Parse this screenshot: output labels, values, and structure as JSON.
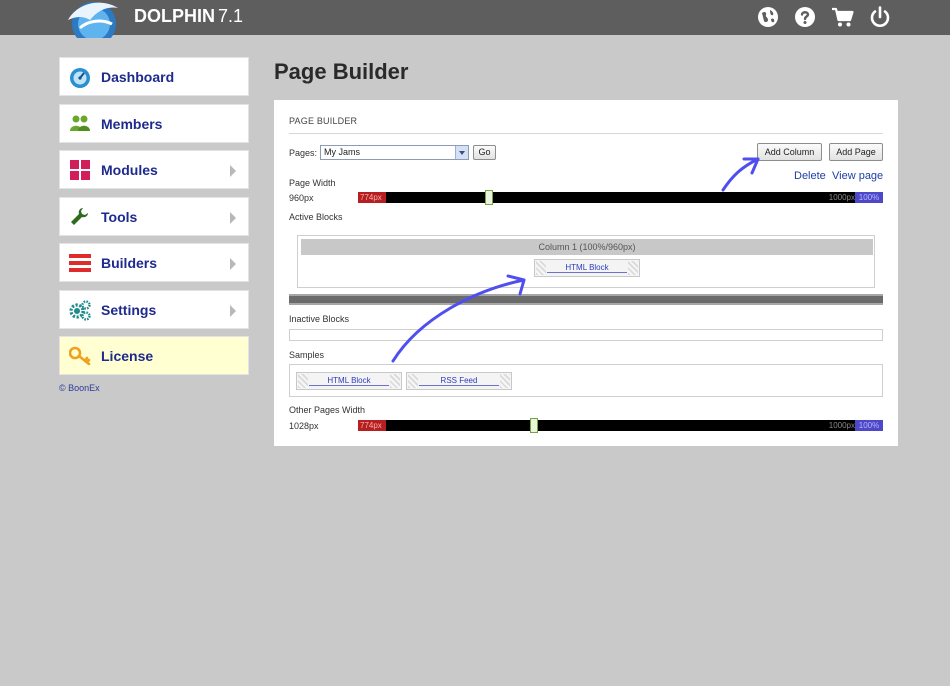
{
  "app": {
    "name": "DOLPHIN",
    "version": "7.1"
  },
  "topbar_icons": [
    "globe-icon",
    "help-icon",
    "cart-icon",
    "power-icon"
  ],
  "sidebar": {
    "items": [
      {
        "label": "Dashboard",
        "icon": "dashboard-icon",
        "has_arrow": false
      },
      {
        "label": "Members",
        "icon": "members-icon",
        "has_arrow": false
      },
      {
        "label": "Modules",
        "icon": "modules-icon",
        "has_arrow": true
      },
      {
        "label": "Tools",
        "icon": "wrench-icon",
        "has_arrow": true
      },
      {
        "label": "Builders",
        "icon": "builders-icon",
        "has_arrow": true
      },
      {
        "label": "Settings",
        "icon": "gears-icon",
        "has_arrow": true
      },
      {
        "label": "License",
        "icon": "key-icon",
        "has_arrow": false
      }
    ],
    "copyright": "© BoonEx"
  },
  "page_title": "Page Builder",
  "panel": {
    "heading": "PAGE BUILDER",
    "pages_label": "Pages:",
    "pages_selected": "My Jams",
    "go_button": "Go",
    "add_column_button": "Add Column",
    "add_page_button": "Add Page",
    "delete_link": "Delete",
    "view_page_link": "View page",
    "page_width": {
      "label": "Page Width",
      "value": "960px",
      "min_label": "774px",
      "max_label": "1000px",
      "pct_label": "100%",
      "fraction": 0.246
    },
    "active_blocks": {
      "label": "Active Blocks",
      "column_title": "Column 1 (100%/960px)",
      "blocks": [
        "HTML Block"
      ]
    },
    "inactive_blocks_label": "Inactive Blocks",
    "samples": {
      "label": "Samples",
      "blocks": [
        "HTML Block",
        "RSS Feed"
      ]
    },
    "other_pages_width": {
      "label": "Other Pages Width",
      "value": "1028px",
      "min_label": "774px",
      "max_label": "1000px",
      "pct_label": "100%",
      "fraction": 0.333
    }
  },
  "colors": {
    "topbar": "#5e5e5e",
    "background": "#c9c9c9",
    "sidebar_link": "#1e2a8c",
    "slider_min": "#b51f1f",
    "slider_max": "#4c48c7",
    "annotation": "#4f4ff0"
  }
}
